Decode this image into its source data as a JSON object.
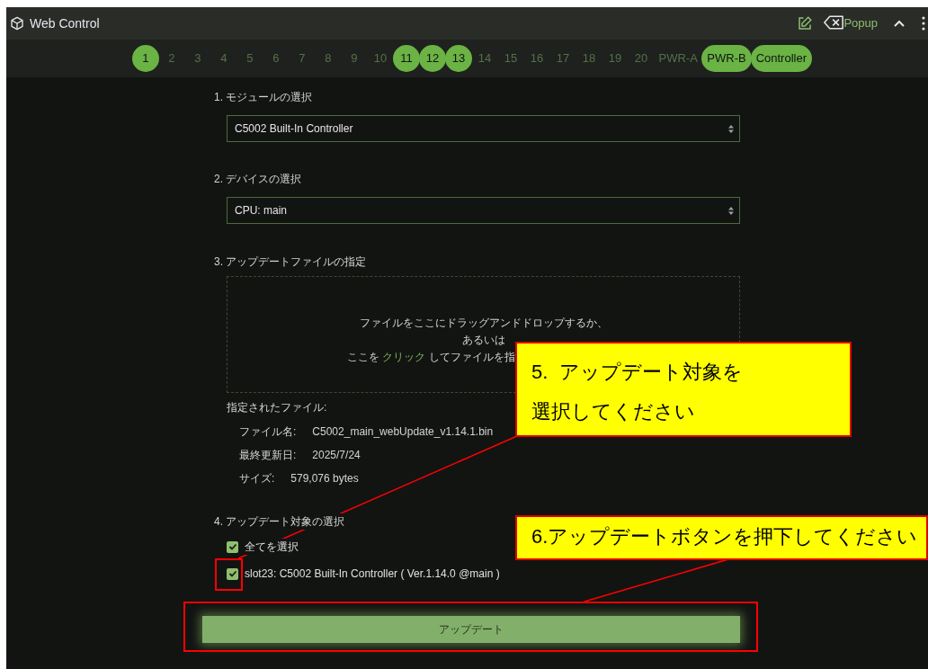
{
  "window": {
    "title": "Web Control",
    "popup_label": "Popup"
  },
  "tabs": [
    {
      "label": "1",
      "selected": true
    },
    {
      "label": "2",
      "selected": false
    },
    {
      "label": "3",
      "selected": false
    },
    {
      "label": "4",
      "selected": false
    },
    {
      "label": "5",
      "selected": false
    },
    {
      "label": "6",
      "selected": false
    },
    {
      "label": "7",
      "selected": false
    },
    {
      "label": "8",
      "selected": false
    },
    {
      "label": "9",
      "selected": false
    },
    {
      "label": "10",
      "selected": false
    },
    {
      "label": "11",
      "selected": true
    },
    {
      "label": "12",
      "selected": true
    },
    {
      "label": "13",
      "selected": true
    },
    {
      "label": "14",
      "selected": false
    },
    {
      "label": "15",
      "selected": false
    },
    {
      "label": "16",
      "selected": false
    },
    {
      "label": "17",
      "selected": false
    },
    {
      "label": "18",
      "selected": false
    },
    {
      "label": "19",
      "selected": false
    },
    {
      "label": "20",
      "selected": false
    },
    {
      "label": "PWR-A",
      "selected": false
    },
    {
      "label": "PWR-B",
      "selected": true
    },
    {
      "label": "Controller",
      "selected": true
    }
  ],
  "module_select": {
    "label": "1. モジュールの選択",
    "value": "C5002 Built-In Controller"
  },
  "device_select": {
    "label": "2. デバイスの選択",
    "value": "CPU: main"
  },
  "file_section": {
    "label": "3. アップデートファイルの指定",
    "drop_zone": {
      "line_1": "ファイルをここにドラッグアンドドロップするか、",
      "line_2": "あるいは",
      "line_3_prefix": "ここを ",
      "line_3_link": "クリック",
      "line_3_suffix": " してファイルを指"
    },
    "selected_file": {
      "heading": "指定されたファイル:",
      "rows": [
        {
          "label": "ファイル名:",
          "value": "C5002_main_webUpdate_v1.14.1.bin"
        },
        {
          "label": "最終更新日:",
          "value": "2025/7/24"
        },
        {
          "label": "サイズ:",
          "value": "579,076 bytes"
        }
      ]
    }
  },
  "targets": {
    "label": "4. アップデート対象の選択",
    "options": [
      {
        "label": "全てを選択",
        "checked": true
      },
      {
        "label": "slot23: C5002 Built-In Controller ( Ver.1.14.0 @main )",
        "checked": true
      }
    ]
  },
  "update_button": "アップデート",
  "callouts": [
    {
      "lines": [
        "5.  アップデート対象を",
        "選択してください"
      ]
    },
    {
      "lines": [
        "6.アップデートボタンを押下してください"
      ]
    }
  ]
}
